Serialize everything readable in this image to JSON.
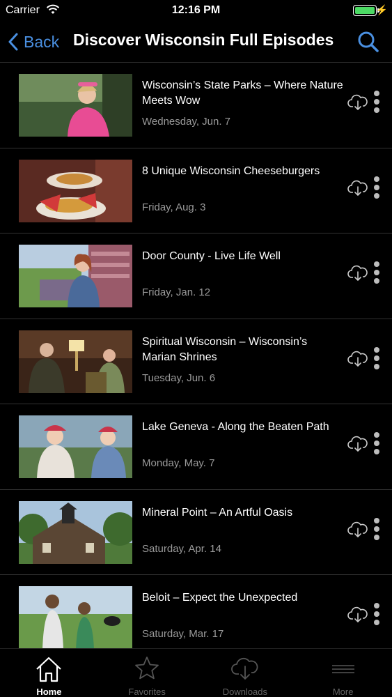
{
  "status_bar": {
    "carrier": "Carrier",
    "time": "12:16 PM"
  },
  "nav": {
    "back_label": "Back",
    "title": "Discover Wisconsin Full Episodes"
  },
  "episodes": [
    {
      "title": "Wisconsin’s State Parks – Where Nature Meets Wow",
      "date": "Wednesday, Jun. 7"
    },
    {
      "title": "8 Unique Wisconsin Cheeseburgers",
      "date": "Friday, Aug. 3"
    },
    {
      "title": "Door County - Live Life Well",
      "date": "Friday, Jan. 12"
    },
    {
      "title": "Spiritual Wisconsin – Wisconsin’s Marian Shrines",
      "date": "Tuesday, Jun. 6"
    },
    {
      "title": "Lake Geneva - Along the Beaten Path",
      "date": "Monday, May. 7"
    },
    {
      "title": "Mineral Point – An Artful Oasis",
      "date": "Saturday, Apr. 14"
    },
    {
      "title": "Beloit – Expect the Unexpected",
      "date": "Saturday, Mar. 17"
    }
  ],
  "tabs": [
    {
      "label": "Home",
      "icon": "home-icon",
      "active": true
    },
    {
      "label": "Favorites",
      "icon": "star-icon",
      "active": false
    },
    {
      "label": "Downloads",
      "icon": "cloud-download-icon",
      "active": false
    },
    {
      "label": "More",
      "icon": "menu-lines-icon",
      "active": false
    }
  ],
  "colors": {
    "accent": "#4a90e2",
    "battery": "#4cd964",
    "background": "#000000",
    "date_text": "#9a9a9a"
  }
}
